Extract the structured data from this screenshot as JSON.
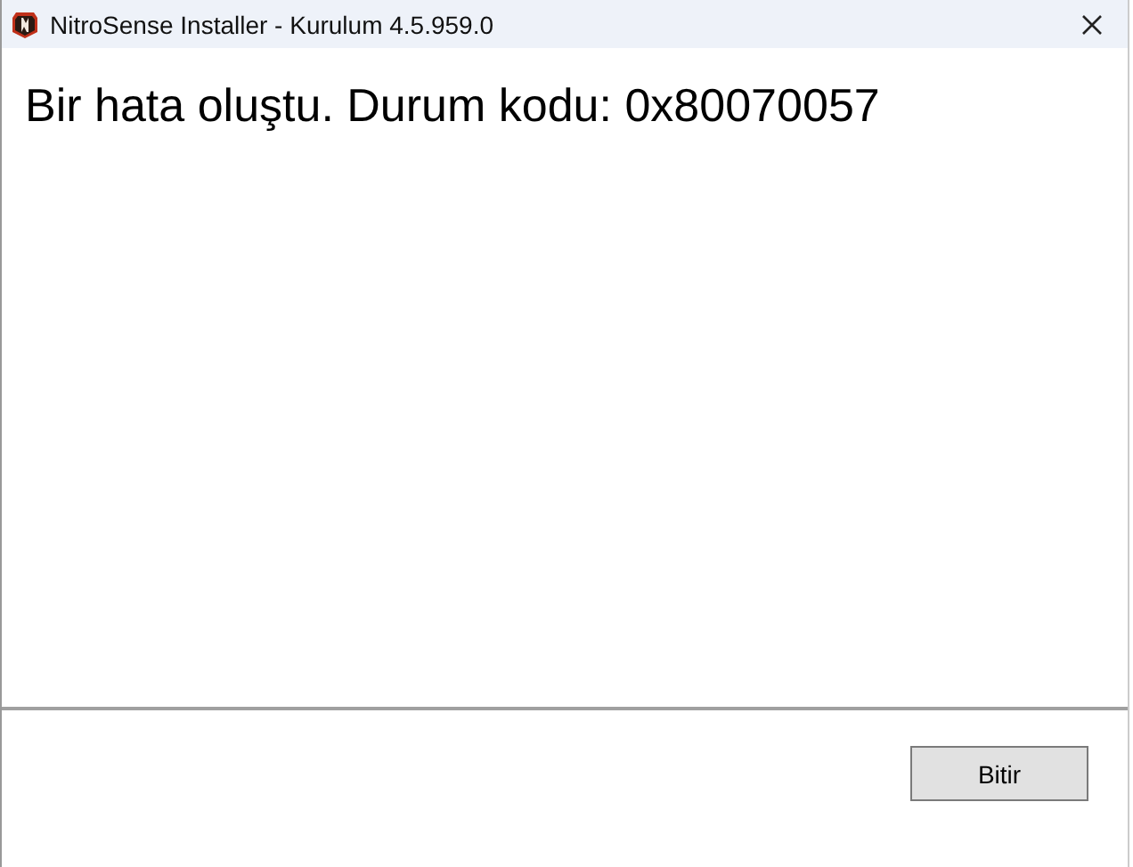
{
  "window": {
    "title": "NitroSense Installer - Kurulum 4.5.959.0"
  },
  "message": "Bir hata oluştu. Durum kodu: 0x80070057",
  "buttons": [
    "Bitir"
  ]
}
